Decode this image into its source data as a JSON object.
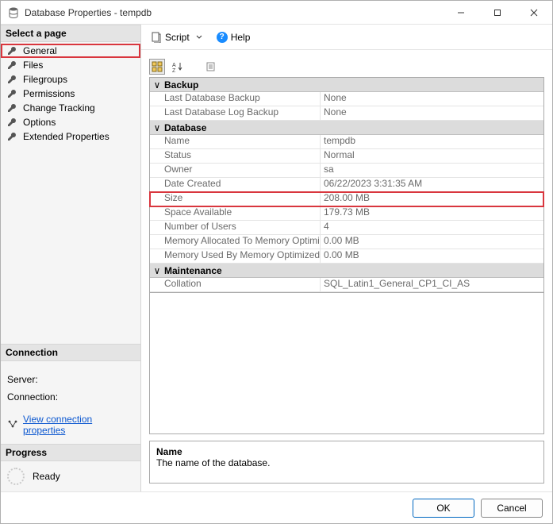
{
  "window": {
    "title": "Database Properties - tempdb"
  },
  "nav": {
    "select_page_hdr": "Select a page",
    "items": [
      {
        "label": "General",
        "selected": true
      },
      {
        "label": "Files"
      },
      {
        "label": "Filegroups"
      },
      {
        "label": "Permissions"
      },
      {
        "label": "Change Tracking"
      },
      {
        "label": "Options"
      },
      {
        "label": "Extended Properties"
      }
    ],
    "connection_hdr": "Connection",
    "server_label": "Server:",
    "connection_label": "Connection:",
    "view_conn_link": "View connection properties",
    "progress_hdr": "Progress",
    "progress_status": "Ready"
  },
  "toolbar": {
    "script": "Script",
    "help": "Help"
  },
  "props": {
    "categories": [
      {
        "name": "Backup",
        "rows": [
          {
            "key": "Last Database Backup",
            "val": "None"
          },
          {
            "key": "Last Database Log Backup",
            "val": "None"
          }
        ]
      },
      {
        "name": "Database",
        "rows": [
          {
            "key": "Name",
            "val": "tempdb"
          },
          {
            "key": "Status",
            "val": "Normal"
          },
          {
            "key": "Owner",
            "val": "sa"
          },
          {
            "key": "Date Created",
            "val": "06/22/2023 3:31:35 AM"
          },
          {
            "key": "Size",
            "val": "208.00 MB",
            "highlight": true
          },
          {
            "key": "Space Available",
            "val": "179.73 MB"
          },
          {
            "key": "Number of Users",
            "val": "4"
          },
          {
            "key": "Memory Allocated To Memory Optimized Objects",
            "val": "0.00 MB"
          },
          {
            "key": "Memory Used By Memory Optimized Objects",
            "val": "0.00 MB"
          }
        ]
      },
      {
        "name": "Maintenance",
        "rows": [
          {
            "key": "Collation",
            "val": "SQL_Latin1_General_CP1_CI_AS"
          }
        ]
      }
    ]
  },
  "desc": {
    "title": "Name",
    "body": "The name of the database."
  },
  "buttons": {
    "ok": "OK",
    "cancel": "Cancel"
  }
}
